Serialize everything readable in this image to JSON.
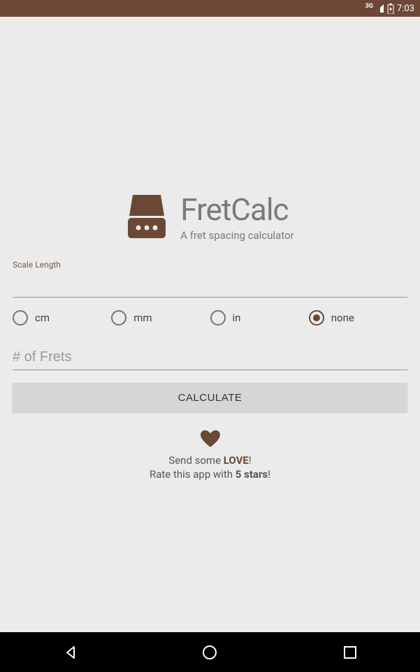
{
  "status": {
    "network": "3G",
    "time": "7:03"
  },
  "app": {
    "title": "FretCalc",
    "subtitle": "A fret spacing calculator"
  },
  "scale_length": {
    "label": "Scale Length",
    "value": ""
  },
  "units": {
    "options": [
      {
        "label": "cm",
        "selected": false
      },
      {
        "label": "mm",
        "selected": false
      },
      {
        "label": "in",
        "selected": false
      },
      {
        "label": "none",
        "selected": true
      }
    ]
  },
  "frets": {
    "placeholder": "# of Frets",
    "value": ""
  },
  "calculate_label": "CALCULATE",
  "love": {
    "send_prefix": "Send some ",
    "send_bold": "LOVE",
    "send_suffix": "!",
    "rate_prefix": "Rate this app with ",
    "rate_bold": "5 stars",
    "rate_suffix": "!"
  }
}
